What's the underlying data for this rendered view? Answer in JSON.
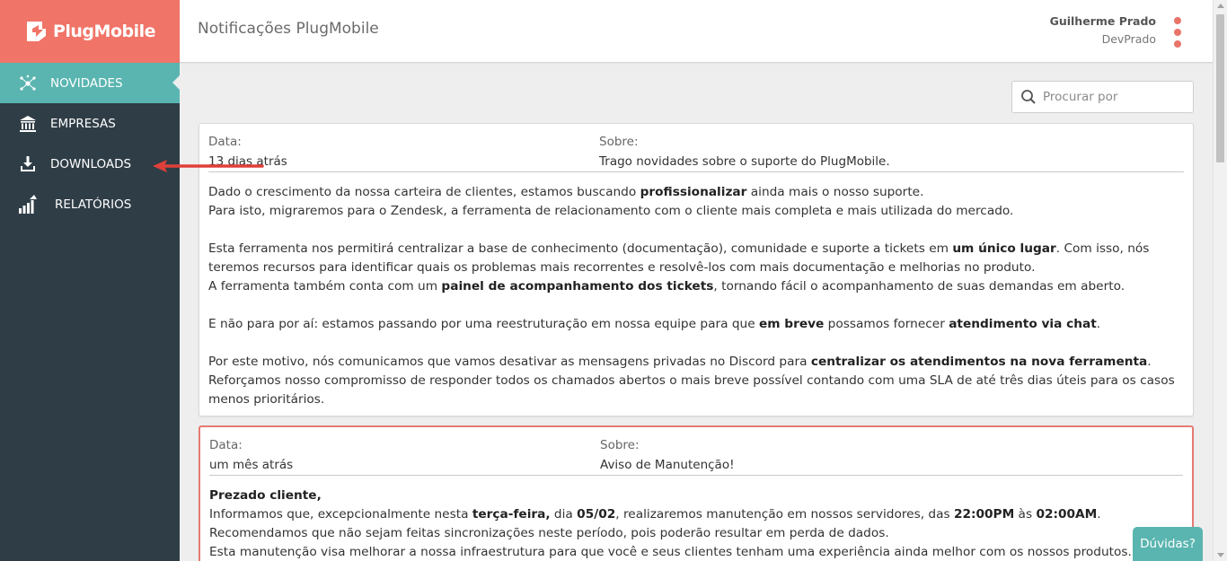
{
  "brand": {
    "name": "PlugMobile"
  },
  "sidebar": {
    "items": [
      {
        "label": "NOVIDADES",
        "icon": "network-icon",
        "active": true
      },
      {
        "label": "EMPRESAS",
        "icon": "bank-icon"
      },
      {
        "label": "DOWNLOADS",
        "icon": "download-icon"
      },
      {
        "label": "RELATÓRIOS",
        "icon": "bar-chart-icon"
      }
    ]
  },
  "header": {
    "title": "Notificações PlugMobile",
    "user_name": "Guilherme Prado",
    "user_role": "DevPrado"
  },
  "search": {
    "placeholder": "Procurar por"
  },
  "cards": [
    {
      "date_label": "Data:",
      "date_value": "13 dias atrás",
      "about_label": "Sobre:",
      "about_value": "Trago novidades sobre o suporte do PlugMobile.",
      "lines": [
        [
          "Dado o crescimento da nossa carteira de clientes, estamos buscando ",
          "profissionalizar",
          " ainda mais o nosso suporte."
        ],
        [
          "Para isto, migraremos para o Zendesk, a ferramenta de relacionamento com o cliente mais completa e mais utilizada do mercado."
        ],
        [],
        [
          "Esta ferramenta nos permitirá centralizar a base de conhecimento (documentação), comunidade e suporte a tickets em ",
          "um único lugar",
          ". Com isso, nós teremos recursos para identificar quais os problemas mais recorrentes e resolvê-los com mais documentação e melhorias no produto."
        ],
        [
          "A ferramenta também conta com um ",
          "painel de acompanhamento dos tickets",
          ", tornando fácil o acompanhamento de suas demandas em aberto."
        ],
        [],
        [
          "E não para por aí: estamos passando por uma reestruturação em nossa equipe para que ",
          "em breve",
          " possamos fornecer ",
          "atendimento via chat",
          "."
        ],
        [],
        [
          "Por este motivo, nós comunicamos que vamos desativar as mensagens privadas no Discord para ",
          "centralizar os atendimentos na nova ferramenta",
          "."
        ],
        [
          "Reforçamos nosso compromisso de responder todos os chamados abertos o mais breve possível contando com uma SLA de até três dias úteis para os casos menos prioritários."
        ]
      ]
    },
    {
      "date_label": "Data:",
      "date_value": "um mês atrás",
      "about_label": "Sobre:",
      "about_value": "Aviso de Manutenção!",
      "lines": [
        [
          "",
          "Prezado cliente,"
        ],
        [
          "Informamos que, excepcionalmente nesta ",
          "terça-feira,",
          " dia ",
          "05/02",
          ", realizaremos manutenção em nossos servidores, das ",
          "22:00PM",
          " às ",
          "02:00AM",
          "."
        ],
        [
          "Recomendamos que não sejam feitas sincronizações neste período, pois poderão resultar em perda de dados."
        ],
        [
          "Esta manutenção visa melhorar a nossa infraestrutura para que você e seus clientes tenham uma experiência ainda melhor com os nossos produtos."
        ]
      ]
    }
  ],
  "help": {
    "label": "Dúvidas?"
  },
  "colors": {
    "sidebar": "#2f3d46",
    "accent": "#5ab5b0",
    "brand": "#f07467",
    "arrow": "#e0403a"
  }
}
